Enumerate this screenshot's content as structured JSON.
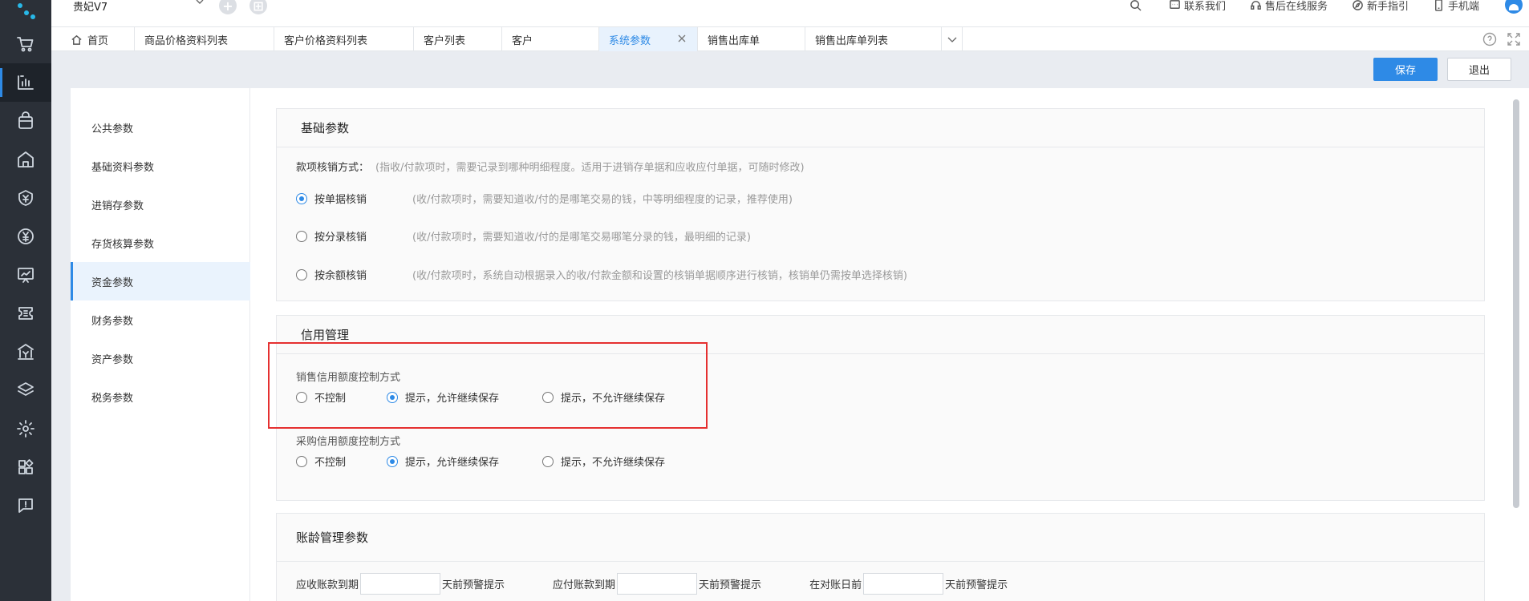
{
  "topbar": {
    "account": "贵妃V7",
    "actions": [
      {
        "icon": "search-icon",
        "label": ""
      },
      {
        "icon": "chat-icon",
        "label": "联系我们"
      },
      {
        "icon": "headset-icon",
        "label": "售后在线服务"
      },
      {
        "icon": "compass-icon",
        "label": "新手指引"
      },
      {
        "icon": "phone-icon",
        "label": "手机端"
      }
    ]
  },
  "tabs": [
    {
      "label": "首页",
      "icon": "home-icon",
      "active": false
    },
    {
      "label": "商品价格资料列表",
      "active": false
    },
    {
      "label": "客户价格资料列表",
      "active": false
    },
    {
      "label": "客户列表",
      "active": false
    },
    {
      "label": "客户",
      "active": false
    },
    {
      "label": "系统参数",
      "active": true
    },
    {
      "label": "销售出库单",
      "active": false
    },
    {
      "label": "销售出库单列表",
      "active": false
    }
  ],
  "buttons": {
    "save": "保存",
    "exit": "退出"
  },
  "rail": [
    "cart-icon",
    "report-icon",
    "bag-icon",
    "store-icon",
    "finance-icon",
    "yuan-icon",
    "chart-board-icon",
    "ticket-icon",
    "bank-icon",
    "layers-icon",
    "gear-icon",
    "apps-icon",
    "feedback-icon"
  ],
  "sidenav": [
    "公共参数",
    "基础资料参数",
    "进销存参数",
    "存货核算参数",
    "资金参数",
    "财务参数",
    "资产参数",
    "税务参数"
  ],
  "sidenav_active": "资金参数",
  "basic": {
    "title": "基础参数",
    "method_label": "款项核销方式：",
    "method_hint": "(指收/付款项时，需要记录到哪种明细程度。适用于进销存单据和应收应付单据，可随时修改)",
    "options": [
      {
        "label": "按单据核销",
        "hint": "(收/付款项时，需要知道收/付的是哪笔交易的钱，中等明细程度的记录，推荐使用)",
        "checked": true
      },
      {
        "label": "按分录核销",
        "hint": "(收/付款项时，需要知道收/付的是哪笔交易哪笔分录的钱，最明细的记录)",
        "checked": false
      },
      {
        "label": "按余额核销",
        "hint": "(收/付款项时，系统自动根据录入的收/付款金额和设置的核销单据顺序进行核销，核销单仍需按单选择核销)",
        "checked": false
      }
    ]
  },
  "credit": {
    "title": "信用管理",
    "sales_label": "销售信用额度控制方式",
    "purchase_label": "采购信用额度控制方式",
    "options": [
      "不控制",
      "提示，允许继续保存",
      "提示，不允许继续保存"
    ],
    "sales_selected": 1,
    "purchase_selected": 1
  },
  "aging": {
    "title": "账龄管理参数",
    "fields": [
      {
        "prefix": "应收账款到期",
        "value": "",
        "suffix": "天前预警提示"
      },
      {
        "prefix": "应付账款到期",
        "value": "",
        "suffix": "天前预警提示"
      },
      {
        "prefix": "在对账日前",
        "value": "",
        "suffix": "天前预警提示"
      }
    ]
  }
}
